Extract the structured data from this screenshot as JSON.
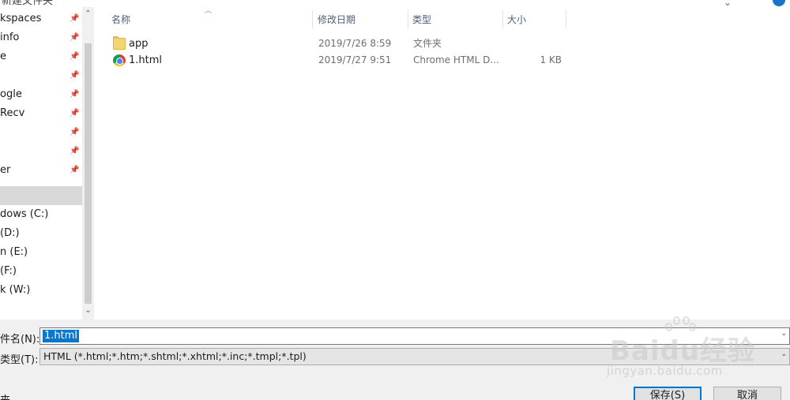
{
  "window": {
    "title_fragment": "新建文件夹"
  },
  "nav": {
    "items": [
      {
        "label": "kspaces",
        "pinned": true
      },
      {
        "label": "info",
        "pinned": true
      },
      {
        "label": "e",
        "pinned": true
      },
      {
        "label": "",
        "pinned": true
      },
      {
        "label": "ogle",
        "pinned": true
      },
      {
        "label": "Recv",
        "pinned": true
      },
      {
        "label": "",
        "pinned": true
      },
      {
        "label": "",
        "pinned": true
      },
      {
        "label": "er",
        "pinned": true
      },
      {
        "label": "",
        "pinned": false,
        "selected": true
      },
      {
        "label": "dows (C:)",
        "pinned": false
      },
      {
        "label": "(D:)",
        "pinned": false
      },
      {
        "label": "n (E:)",
        "pinned": false
      },
      {
        "label": "(F:)",
        "pinned": false
      },
      {
        "label": "k (W:)",
        "pinned": false
      }
    ]
  },
  "list": {
    "columns": {
      "name": "名称",
      "date": "修改日期",
      "type": "类型",
      "size": "大小"
    },
    "rows": [
      {
        "icon": "folder-icon",
        "name": "app",
        "date": "2019/7/26 8:59",
        "type": "文件夹",
        "size": ""
      },
      {
        "icon": "chrome-html-icon",
        "name": "1.html",
        "date": "2019/7/27 9:51",
        "type": "Chrome HTML D...",
        "size": "1 KB"
      }
    ]
  },
  "footer": {
    "filename_label": "件名(N):",
    "filename_value": "1.html",
    "filetype_label": "类型(T):",
    "filetype_value": "HTML (*.html;*.htm;*.shtml;*.xhtml;*.inc;*.tmpl;*.tpl)",
    "hide_folders_label": "夹",
    "save_label": "保存(S)",
    "cancel_label": "取消"
  },
  "watermark": {
    "brand": "Baidu经验",
    "url": "jingyan.baidu.com"
  },
  "colors": {
    "accent": "#0078d7",
    "header_text": "#4c607a",
    "bottom_bg": "#f0f0f0"
  }
}
